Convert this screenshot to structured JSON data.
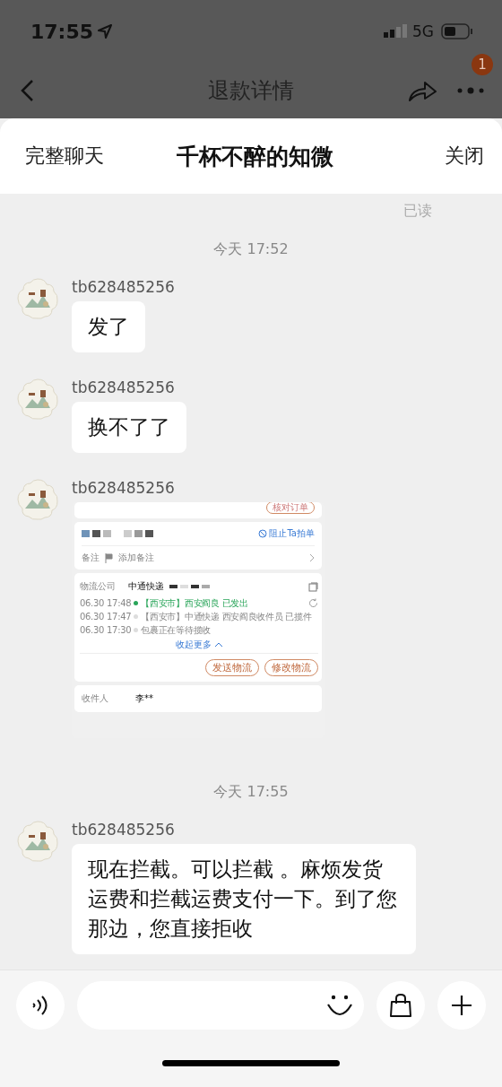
{
  "status_bar": {
    "time": "17:55",
    "network": "5G"
  },
  "nav": {
    "title": "退款详情",
    "badge": "1"
  },
  "sheet": {
    "left": "完整聊天",
    "title": "千杯不醉的知微",
    "right": "关闭"
  },
  "chat": {
    "read_receipt": "已读",
    "items": [
      {
        "kind": "timestamp",
        "text": "今天 17:52"
      },
      {
        "kind": "message",
        "sender": "tb628485256",
        "text": "发了"
      },
      {
        "kind": "message",
        "sender": "tb628485256",
        "text": "换不了了"
      },
      {
        "kind": "image",
        "sender": "tb628485256",
        "shot": {
          "top_button": "核对订单",
          "block_action": "阻止Ta拍单",
          "note_label": "备注",
          "note_action": "添加备注",
          "carrier_label": "物流公司",
          "carrier": "中通快递",
          "events": [
            {
              "time": "06.30 17:48",
              "text": "【西安市】西安阎良 已发出",
              "current": true
            },
            {
              "time": "06.30 17:47",
              "text": "【西安市】中通快递 西安阎良收件员 已揽件",
              "current": false
            },
            {
              "time": "06.30 17:30",
              "text": "包裹正在等待揽收",
              "current": false
            }
          ],
          "collapse": "收起更多",
          "buttons": [
            "发送物流",
            "修改物流"
          ],
          "recipient_label": "收件人",
          "recipient": "李**"
        }
      },
      {
        "kind": "timestamp",
        "text": "今天 17:55"
      },
      {
        "kind": "message",
        "sender": "tb628485256",
        "text": "现在拦截。可以拦截 。麻烦发货运费和拦截运费支付一下。到了您那边，您直接拒收"
      }
    ]
  }
}
